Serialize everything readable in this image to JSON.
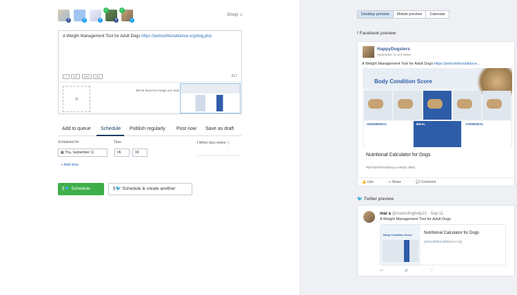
{
  "profiles": {
    "emoji_link": "Emoji ☺"
  },
  "composer": {
    "text_plain": "A Weight Management Tool for Adult Dogs ",
    "text_link": "https://petnutritionalliance.org/dog.php",
    "char_count": "217",
    "found_text": "We've found an Image you may like"
  },
  "tabs": [
    "Add to queue",
    "Schedule",
    "Publish regularly",
    "Post now",
    "Save as draft"
  ],
  "schedule": {
    "scheduled_for_label": "Scheduled for",
    "time_label": "Time",
    "date_value": "Thu, September 11",
    "hour_value": "06",
    "minute_value": "00",
    "fb_online_label": "When fans online",
    "add_time_label": "+ Add time"
  },
  "buttons": {
    "schedule": "Schedule",
    "schedule_another": "Schedule & create another"
  },
  "preview_tabs": [
    "Desktop preview",
    "Mobile preview",
    "Calendar"
  ],
  "facebook": {
    "section_title": "Facebook preview",
    "page_name": "HappyDogsters",
    "date": "September 11 at 6:00am",
    "post_text_plain": "A Weight Management Tool for Adult Dogs ",
    "post_text_link": "https://petnutritionalliance...",
    "image_title": "Body Condition Score",
    "label_underideal": "UNDERIDEAL",
    "label_ideal": "IDEAL",
    "label_overideal": "OVERIDEAL",
    "link_title": "Nutritional Calculator for Dogs",
    "link_domain": "PETNUTRITIONALLIANCE.ORG",
    "actions": [
      "Like",
      "Share",
      "Comment"
    ]
  },
  "twitter": {
    "section_title": "Twitter preview",
    "name": "mar a",
    "handle": "@marketinghelp21 · Sep 11",
    "text": "A Weight Management Tool for Adult Dogs",
    "card_title": "Nutritional Calculator for Dogs",
    "card_domain": "petnutritionalliance.org",
    "image_title": "Body Condition Score"
  },
  "icons": {
    "facebook": "facebook-icon",
    "twitter": "twitter-icon",
    "add-image": "add-image-icon",
    "info": "info-icon"
  },
  "colors": {
    "schedule_green": "#3fae49",
    "link_blue": "#2c6fbb",
    "facebook_blue": "#3b5998",
    "twitter_blue": "#1da1f2",
    "panel_gray": "#eef0f3"
  }
}
